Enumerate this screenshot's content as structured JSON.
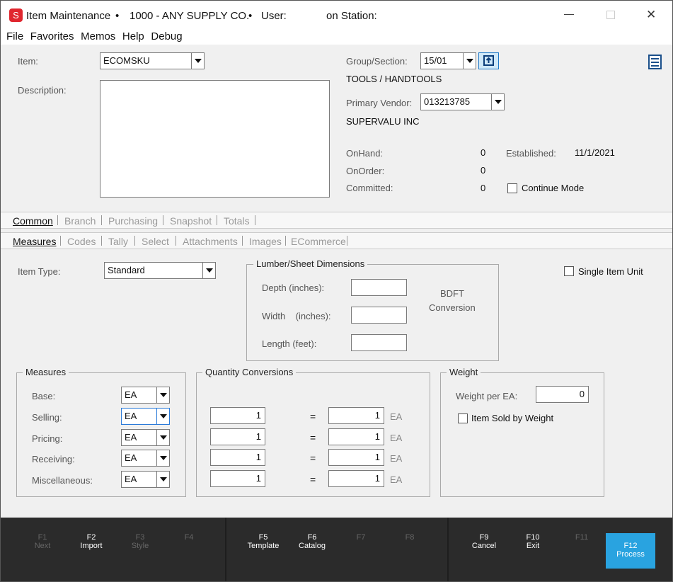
{
  "titlebar": {
    "app_title": "Item Maintenance",
    "company": "1000 - ANY SUPPLY CO.",
    "user_label": "User:",
    "station_label": "on Station:",
    "bullet": "•",
    "app_icon_letter": "S",
    "minimize_glyph": "—",
    "close_glyph": "✕"
  },
  "menu": [
    "File",
    "Favorites",
    "Memos",
    "Help",
    "Debug"
  ],
  "header": {
    "item_label": "Item:",
    "item_value": "ECOMSKU",
    "description_label": "Description:",
    "group_label": "Group/Section:",
    "group_value": "15/01",
    "group_name": "TOOLS / HANDTOOLS",
    "vendor_label": "Primary Vendor:",
    "vendor_value": "013213785",
    "vendor_name": "SUPERVALU INC",
    "onhand_label": "OnHand:",
    "onhand_value": "0",
    "onorder_label": "OnOrder:",
    "onorder_value": "0",
    "committed_label": "Committed:",
    "committed_value": "0",
    "established_label": "Established:",
    "established_value": "11/1/2021",
    "continue_mode_label": "Continue Mode"
  },
  "main_tabs": [
    "Common",
    "Branch",
    "Purchasing",
    "Snapshot",
    "Totals"
  ],
  "sub_tabs": [
    "Measures",
    "Codes",
    "Tally",
    "Select",
    "Attachments",
    "Images",
    "ECommerce"
  ],
  "measures_tab": {
    "item_type_label": "Item Type:",
    "item_type_value": "Standard",
    "lumber_title": "Lumber/Sheet Dimensions",
    "depth_label": "Depth (inches):",
    "width_label": "Width    (inches):",
    "length_label": "Length (feet):",
    "bdft_label": "BDFT",
    "conversion_label": "Conversion",
    "single_item_unit_label": "Single Item Unit",
    "measures_title": "Measures",
    "measures": [
      {
        "label": "Base:",
        "value": "EA"
      },
      {
        "label": "Selling:",
        "value": "EA"
      },
      {
        "label": "Pricing:",
        "value": "EA"
      },
      {
        "label": "Receiving:",
        "value": "EA"
      },
      {
        "label": "Miscellaneous:",
        "value": "EA"
      }
    ],
    "qc_title": "Quantity Conversions",
    "conversions": [
      {
        "left": "1",
        "eq": "=",
        "right": "1",
        "unit": "EA"
      },
      {
        "left": "1",
        "eq": "=",
        "right": "1",
        "unit": "EA"
      },
      {
        "left": "1",
        "eq": "=",
        "right": "1",
        "unit": "EA"
      },
      {
        "left": "1",
        "eq": "=",
        "right": "1",
        "unit": "EA"
      }
    ],
    "weight_title": "Weight",
    "weight_per_label": "Weight per EA:",
    "weight_per_value": "0",
    "sold_by_weight_label": "Item Sold by Weight"
  },
  "footer_keys": [
    {
      "key": "F1",
      "label": "Next"
    },
    {
      "key": "F2",
      "label": "Import"
    },
    {
      "key": "F3",
      "label": "Style"
    },
    {
      "key": "F4",
      "label": ""
    },
    {
      "key": "F5",
      "label": "Template"
    },
    {
      "key": "F6",
      "label": "Catalog"
    },
    {
      "key": "F7",
      "label": ""
    },
    {
      "key": "F8",
      "label": ""
    },
    {
      "key": "F9",
      "label": "Cancel"
    },
    {
      "key": "F10",
      "label": "Exit"
    },
    {
      "key": "F11",
      "label": ""
    },
    {
      "key": "F12",
      "label": "Process"
    }
  ],
  "colors": {
    "accent": "#29a3e0",
    "app_icon": "#e0262e",
    "footer_bg": "#2b2b2b"
  }
}
